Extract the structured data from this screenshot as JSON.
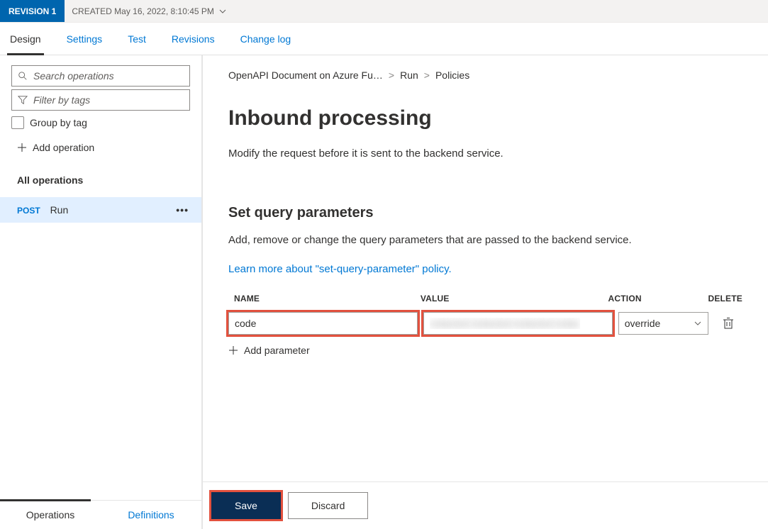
{
  "revision": {
    "badge": "REVISION 1",
    "created_label": "CREATED May 16, 2022, 8:10:45 PM"
  },
  "tabs": [
    {
      "label": "Design",
      "active": true
    },
    {
      "label": "Settings",
      "active": false
    },
    {
      "label": "Test",
      "active": false
    },
    {
      "label": "Revisions",
      "active": false
    },
    {
      "label": "Change log",
      "active": false
    }
  ],
  "sidebar": {
    "search_placeholder": "Search operations",
    "filter_placeholder": "Filter by tags",
    "group_label": "Group by tag",
    "add_operation": "Add operation",
    "all_operations": "All operations",
    "operations": [
      {
        "method": "POST",
        "name": "Run"
      }
    ],
    "bottom_tabs": [
      {
        "label": "Operations",
        "active": true
      },
      {
        "label": "Definitions",
        "active": false
      }
    ]
  },
  "breadcrumb": {
    "items": [
      "OpenAPI Document on Azure Fu…",
      "Run",
      "Policies"
    ]
  },
  "page": {
    "title": "Inbound processing",
    "subtitle": "Modify the request before it is sent to the backend service."
  },
  "section": {
    "title": "Set query parameters",
    "subtitle": "Add, remove or change the query parameters that are passed to the backend service.",
    "learn_more": "Learn more about \"set-query-parameter\" policy."
  },
  "param_table": {
    "headers": {
      "name": "NAME",
      "value": "VALUE",
      "action": "ACTION",
      "delete": "DELETE"
    },
    "rows": [
      {
        "name": "code",
        "value": "redacted-redacted-redacted-redac",
        "action": "override"
      }
    ],
    "add_label": "Add parameter"
  },
  "buttons": {
    "save": "Save",
    "discard": "Discard"
  }
}
